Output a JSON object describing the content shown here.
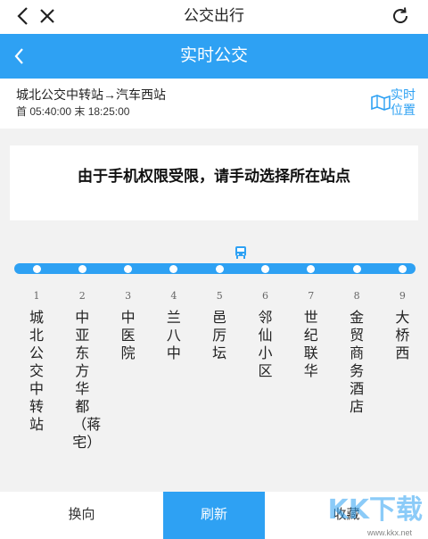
{
  "topbar": {
    "title": "公交出行",
    "back_icon": "chevron-left-icon",
    "close_icon": "close-icon",
    "refresh_icon": "refresh-icon"
  },
  "header": {
    "title": "实时公交",
    "back_icon": "chevron-left-icon",
    "color": "#2ea1f3"
  },
  "route": {
    "name": "城北公交中转站→汽车西站",
    "hours": "首 05:40:00 末 18:25:00",
    "realtime_label_1": "实时",
    "realtime_label_2": "位置",
    "realtime_icon": "map-icon"
  },
  "notice": {
    "text": "由于手机权限受限，请手动选择所在站点"
  },
  "stops": [
    {
      "num": "1",
      "name": "城北公交中转站"
    },
    {
      "num": "2",
      "name": "中亚东方华都（蒋宅）"
    },
    {
      "num": "3",
      "name": "中医院"
    },
    {
      "num": "4",
      "name": "兰八中"
    },
    {
      "num": "5",
      "name": "邑厉坛"
    },
    {
      "num": "6",
      "name": "邻仙小区"
    },
    {
      "num": "7",
      "name": "世纪联华"
    },
    {
      "num": "8",
      "name": "金贸商务酒店"
    },
    {
      "num": "9",
      "name": "大桥西"
    }
  ],
  "bus": {
    "icon": "bus-icon",
    "at_stop": "5"
  },
  "bottom": {
    "reverse": "换向",
    "refresh": "刷新",
    "favorite": "收藏"
  },
  "watermark": {
    "text": "KK下载",
    "url": "www.kkx.net"
  }
}
